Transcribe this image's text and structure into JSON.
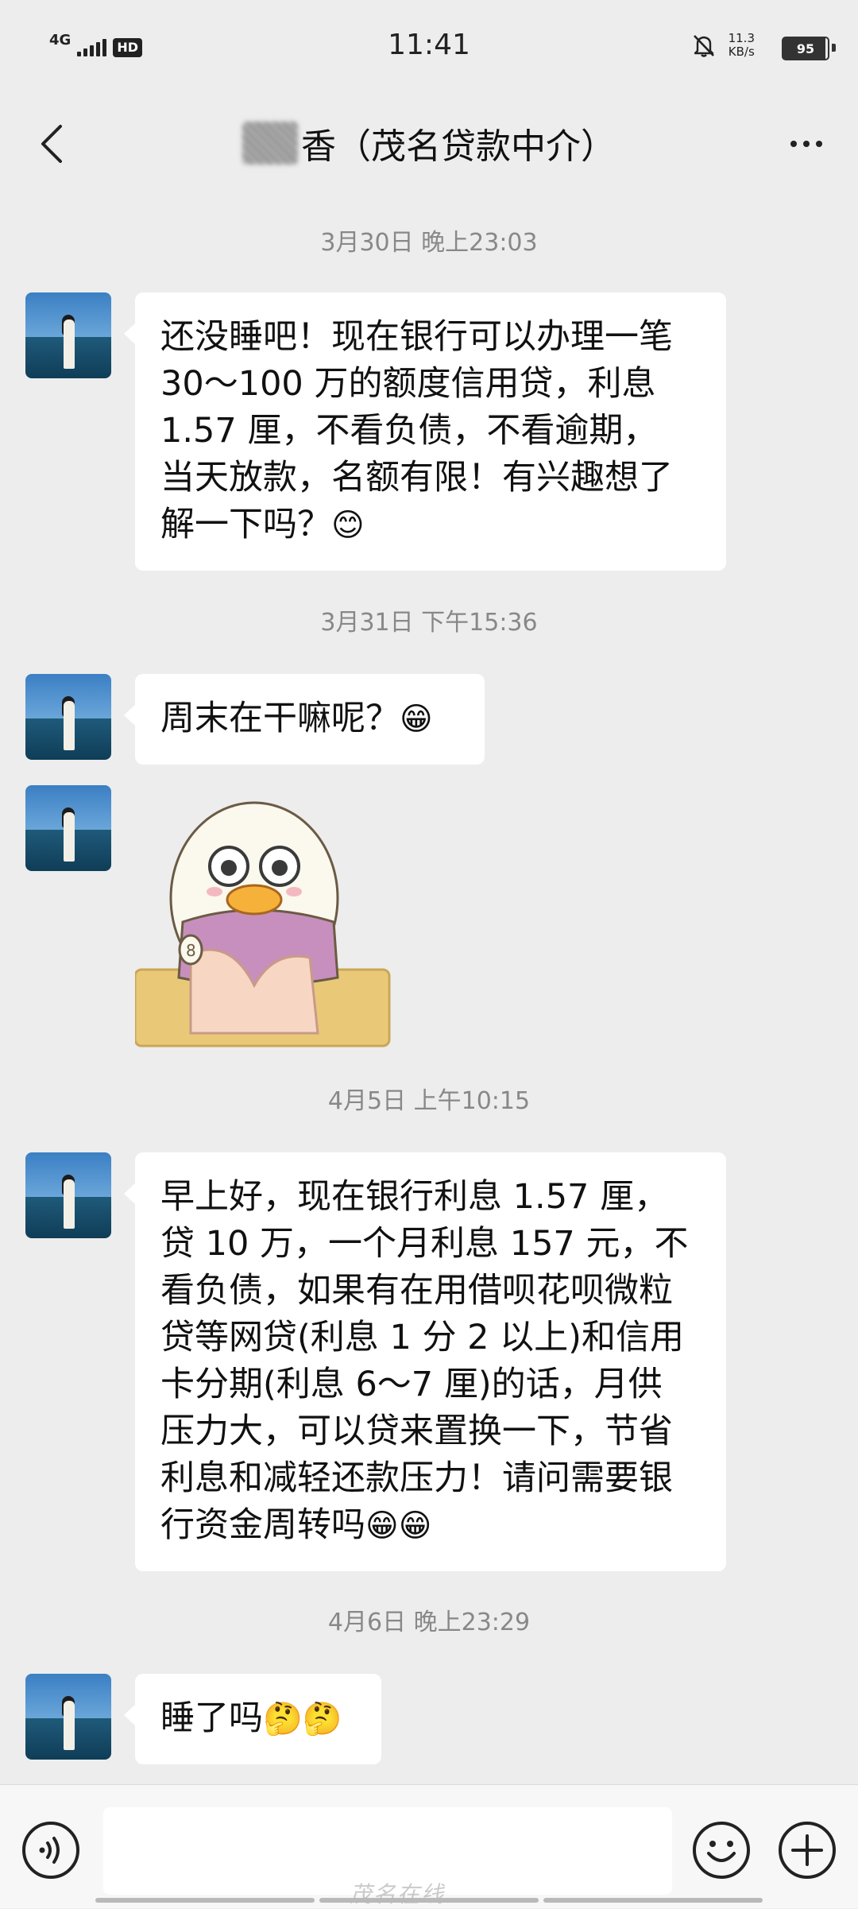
{
  "status_bar": {
    "network": "4G",
    "hd": "HD",
    "time": "11:41",
    "speed_value": "11.3",
    "speed_unit": "KB/s",
    "battery": "95"
  },
  "header": {
    "title": "香（茂名贷款中介）",
    "back_icon": "chevron-left-icon",
    "more_icon": "more-dots-icon"
  },
  "messages": [
    {
      "timestamp": "3月30日 晚上23:03",
      "lines": [
        "还没睡吧！现在银行可以办理一笔",
        "30～100 万的额度信用贷，利息",
        "1.57 厘，不看负债，不看逾期，",
        "当天放款，名额有限！有兴趣想了",
        "解一下吗？"
      ],
      "emoji": "😊"
    },
    {
      "timestamp": "3月31日 下午15:36",
      "lines": [
        "周末在干嘛呢？"
      ],
      "emoji": "😁"
    },
    {
      "timestamp": "4月5日 上午10:15",
      "lines": [
        "早上好，现在银行利息 1.57 厘，",
        "贷 10 万，一个月利息 157 元，不",
        "看负债，如果有在用借呗花呗微粒",
        "贷等网贷(利息 1 分 2 以上)和信用",
        "卡分期(利息 6～7 厘)的话，月供",
        "压力大，可以贷来置换一下，节省",
        "利息和减轻还款压力！请问需要银",
        "行资金周转吗"
      ],
      "emoji": "😁😁"
    },
    {
      "timestamp": "4月6日 晚上23:29",
      "lines": [
        "睡了吗"
      ],
      "emoji": "🤔🤔"
    }
  ],
  "sticker": {
    "name": "duck-sticker",
    "badge": "8"
  },
  "input_bar": {
    "voice_icon": "voice-icon",
    "emoji_icon": "emoji-icon",
    "plus_icon": "plus-icon"
  },
  "watermark": "茂名在线"
}
